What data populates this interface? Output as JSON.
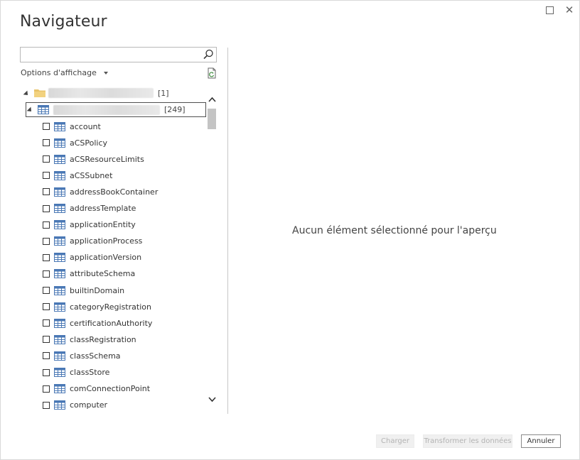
{
  "window": {
    "title": "Navigateur",
    "controls": {
      "maximize_icon": "maximize-icon",
      "close_icon": "close-icon",
      "close_glyph": "✕"
    }
  },
  "search": {
    "value": "",
    "placeholder": "",
    "icon": "search-icon"
  },
  "options": {
    "label": "Options d'affichage",
    "refresh_icon": "refresh-icon"
  },
  "tree": {
    "root": {
      "count": "[1]",
      "icon": "folder-icon"
    },
    "child": {
      "count": "[249]",
      "icon": "table-icon"
    },
    "items": [
      "account",
      "aCSPolicy",
      "aCSResourceLimits",
      "aCSSubnet",
      "addressBookContainer",
      "addressTemplate",
      "applicationEntity",
      "applicationProcess",
      "applicationVersion",
      "attributeSchema",
      "builtinDomain",
      "categoryRegistration",
      "certificationAuthority",
      "classRegistration",
      "classSchema",
      "classStore",
      "comConnectionPoint",
      "computer"
    ]
  },
  "preview": {
    "message": "Aucun élément sélectionné pour l'aperçu"
  },
  "footer": {
    "load_label": "Charger",
    "transform_label": "Transformer les données",
    "cancel_label": "Annuler"
  },
  "colors": {
    "accent": "#4f4f4f",
    "table_icon": "#4a78b5",
    "folder": "#e8c36a",
    "disabled_text": "#b3b3b3"
  }
}
